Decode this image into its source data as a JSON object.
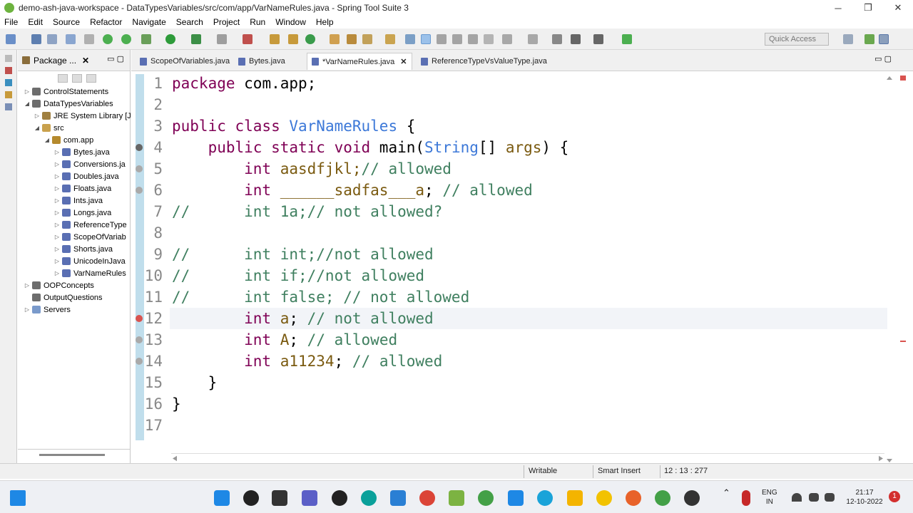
{
  "window": {
    "title": "demo-ash-java-workspace - DataTypesVariables/src/com/app/VarNameRules.java - Spring Tool Suite 3",
    "controls": {
      "minimize": "─",
      "restore": "❐",
      "close": "✕"
    }
  },
  "menu": [
    "File",
    "Edit",
    "Source",
    "Refactor",
    "Navigate",
    "Search",
    "Project",
    "Run",
    "Window",
    "Help"
  ],
  "quick_access": {
    "placeholder": "Quick Access"
  },
  "package_explorer": {
    "tab_label": "Package ...",
    "close": "✕",
    "items": [
      {
        "label": "ControlStatements",
        "kind": "project",
        "expander": "▷"
      },
      {
        "label": "DataTypesVariables",
        "kind": "project",
        "expander": "◢"
      },
      {
        "label": "JRE System Library [J",
        "kind": "lib",
        "expander": "▷"
      },
      {
        "label": "src",
        "kind": "src",
        "expander": "◢"
      },
      {
        "label": "com.app",
        "kind": "pkg",
        "expander": "◢"
      },
      {
        "label": "Bytes.java",
        "kind": "java",
        "expander": "▷"
      },
      {
        "label": "Conversions.ja",
        "kind": "java",
        "expander": "▷"
      },
      {
        "label": "Doubles.java",
        "kind": "java",
        "expander": "▷"
      },
      {
        "label": "Floats.java",
        "kind": "java",
        "expander": "▷"
      },
      {
        "label": "Ints.java",
        "kind": "java",
        "expander": "▷"
      },
      {
        "label": "Longs.java",
        "kind": "java",
        "expander": "▷"
      },
      {
        "label": "ReferenceType",
        "kind": "java",
        "expander": "▷"
      },
      {
        "label": "ScopeOfVariab",
        "kind": "java",
        "expander": "▷"
      },
      {
        "label": "Shorts.java",
        "kind": "java",
        "expander": "▷"
      },
      {
        "label": "UnicodeInJava",
        "kind": "java",
        "expander": "▷"
      },
      {
        "label": "VarNameRules",
        "kind": "java",
        "expander": "▷"
      },
      {
        "label": "OOPConcepts",
        "kind": "project",
        "expander": "▷"
      },
      {
        "label": "OutputQuestions",
        "kind": "project",
        "expander": ""
      },
      {
        "label": "Servers",
        "kind": "server",
        "expander": "▷"
      }
    ]
  },
  "editor": {
    "tabs": [
      {
        "label": "ScopeOfVariables.java",
        "active": false
      },
      {
        "label": "Bytes.java",
        "active": false
      },
      {
        "label": "*VarNameRules.java",
        "active": true
      },
      {
        "label": "ReferenceTypeVsValueType.java",
        "active": false
      }
    ],
    "tab_close": "✕",
    "lines": [
      {
        "n": "1",
        "segs": [
          {
            "t": "package",
            "c": "kw"
          },
          {
            "t": " com.app;",
            "c": ""
          }
        ]
      },
      {
        "n": "2",
        "segs": []
      },
      {
        "n": "3",
        "segs": [
          {
            "t": "public class",
            "c": "kw"
          },
          {
            "t": " ",
            "c": ""
          },
          {
            "t": "VarNameRules",
            "c": "cls"
          },
          {
            "t": " {",
            "c": ""
          }
        ]
      },
      {
        "n": "4",
        "segs": [
          {
            "t": "    public static void",
            "c": "kw"
          },
          {
            "t": " main(",
            "c": ""
          },
          {
            "t": "String",
            "c": "cls"
          },
          {
            "t": "[] ",
            "c": ""
          },
          {
            "t": "args",
            "c": "var"
          },
          {
            "t": ") {",
            "c": ""
          }
        ]
      },
      {
        "n": "5",
        "segs": [
          {
            "t": "        int",
            "c": "kw"
          },
          {
            "t": " aasdfjkl;",
            "c": "var"
          },
          {
            "t": "// allowed",
            "c": "cmt"
          }
        ]
      },
      {
        "n": "6",
        "segs": [
          {
            "t": "        int",
            "c": "kw"
          },
          {
            "t": " ______sadfas___a",
            "c": "var"
          },
          {
            "t": "; ",
            "c": ""
          },
          {
            "t": "// allowed",
            "c": "cmt"
          }
        ]
      },
      {
        "n": "7",
        "segs": [
          {
            "t": "//      int 1a;// not allowed?",
            "c": "cmt"
          }
        ]
      },
      {
        "n": "8",
        "segs": []
      },
      {
        "n": "9",
        "segs": [
          {
            "t": "//      int int;//not allowed",
            "c": "cmt"
          }
        ]
      },
      {
        "n": "10",
        "segs": [
          {
            "t": "//      int if;//not allowed",
            "c": "cmt"
          }
        ]
      },
      {
        "n": "11",
        "segs": [
          {
            "t": "//      int false; // not allowed",
            "c": "cmt"
          }
        ]
      },
      {
        "n": "12",
        "segs": [
          {
            "t": "        int",
            "c": "kw"
          },
          {
            "t": " a",
            "c": "var"
          },
          {
            "t": "; ",
            "c": ""
          },
          {
            "t": "// not allowed",
            "c": "cmt"
          }
        ]
      },
      {
        "n": "13",
        "segs": [
          {
            "t": "        int",
            "c": "kw"
          },
          {
            "t": " A",
            "c": "var"
          },
          {
            "t": "; ",
            "c": ""
          },
          {
            "t": "// allowed",
            "c": "cmt"
          }
        ]
      },
      {
        "n": "14",
        "segs": [
          {
            "t": "        int",
            "c": "kw"
          },
          {
            "t": " a11234",
            "c": "var"
          },
          {
            "t": "; ",
            "c": ""
          },
          {
            "t": "// allowed",
            "c": "cmt"
          }
        ]
      },
      {
        "n": "15",
        "segs": [
          {
            "t": "    }",
            "c": ""
          }
        ]
      },
      {
        "n": "16",
        "segs": [
          {
            "t": "}",
            "c": ""
          }
        ]
      },
      {
        "n": "17",
        "segs": []
      }
    ]
  },
  "status": {
    "writable": "Writable",
    "insert_mode": "Smart Insert",
    "position": "12 : 13 : 277"
  },
  "taskbar": {
    "lang_top": "ENG",
    "lang_bottom": "IN",
    "time": "21:17",
    "date": "12-10-2022",
    "notifications": "1"
  },
  "colors": {
    "keyword": "#7f0055",
    "class": "#3c78d8",
    "comment": "#3f7f5f",
    "variable": "#7a5a10",
    "error": "#d9534f"
  }
}
